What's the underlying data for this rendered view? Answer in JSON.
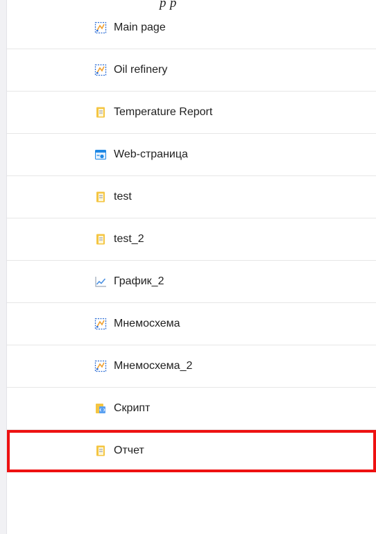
{
  "header_fragment": "p          p",
  "items": [
    {
      "label": "Main page",
      "icon": "mnemoscheme-icon"
    },
    {
      "label": "Oil refinery",
      "icon": "mnemoscheme-icon"
    },
    {
      "label": "Temperature Report",
      "icon": "report-icon"
    },
    {
      "label": "Web-страница",
      "icon": "web-page-icon"
    },
    {
      "label": "test",
      "icon": "report-icon"
    },
    {
      "label": "test_2",
      "icon": "report-icon"
    },
    {
      "label": "График_2",
      "icon": "chart-icon"
    },
    {
      "label": "Мнемосхема",
      "icon": "mnemoscheme-icon"
    },
    {
      "label": "Мнемосхема_2",
      "icon": "mnemoscheme-icon"
    },
    {
      "label": "Скрипт",
      "icon": "script-icon"
    },
    {
      "label": "Отчет",
      "icon": "report-icon",
      "selected": true
    }
  ],
  "colors": {
    "highlight": "#ee1111",
    "mnemo_blue": "#2f6fd6",
    "mnemo_orange": "#f0a030",
    "report_yellow": "#f4c542",
    "web_blue": "#1e88e5",
    "chart_blue": "#4a90e2"
  }
}
